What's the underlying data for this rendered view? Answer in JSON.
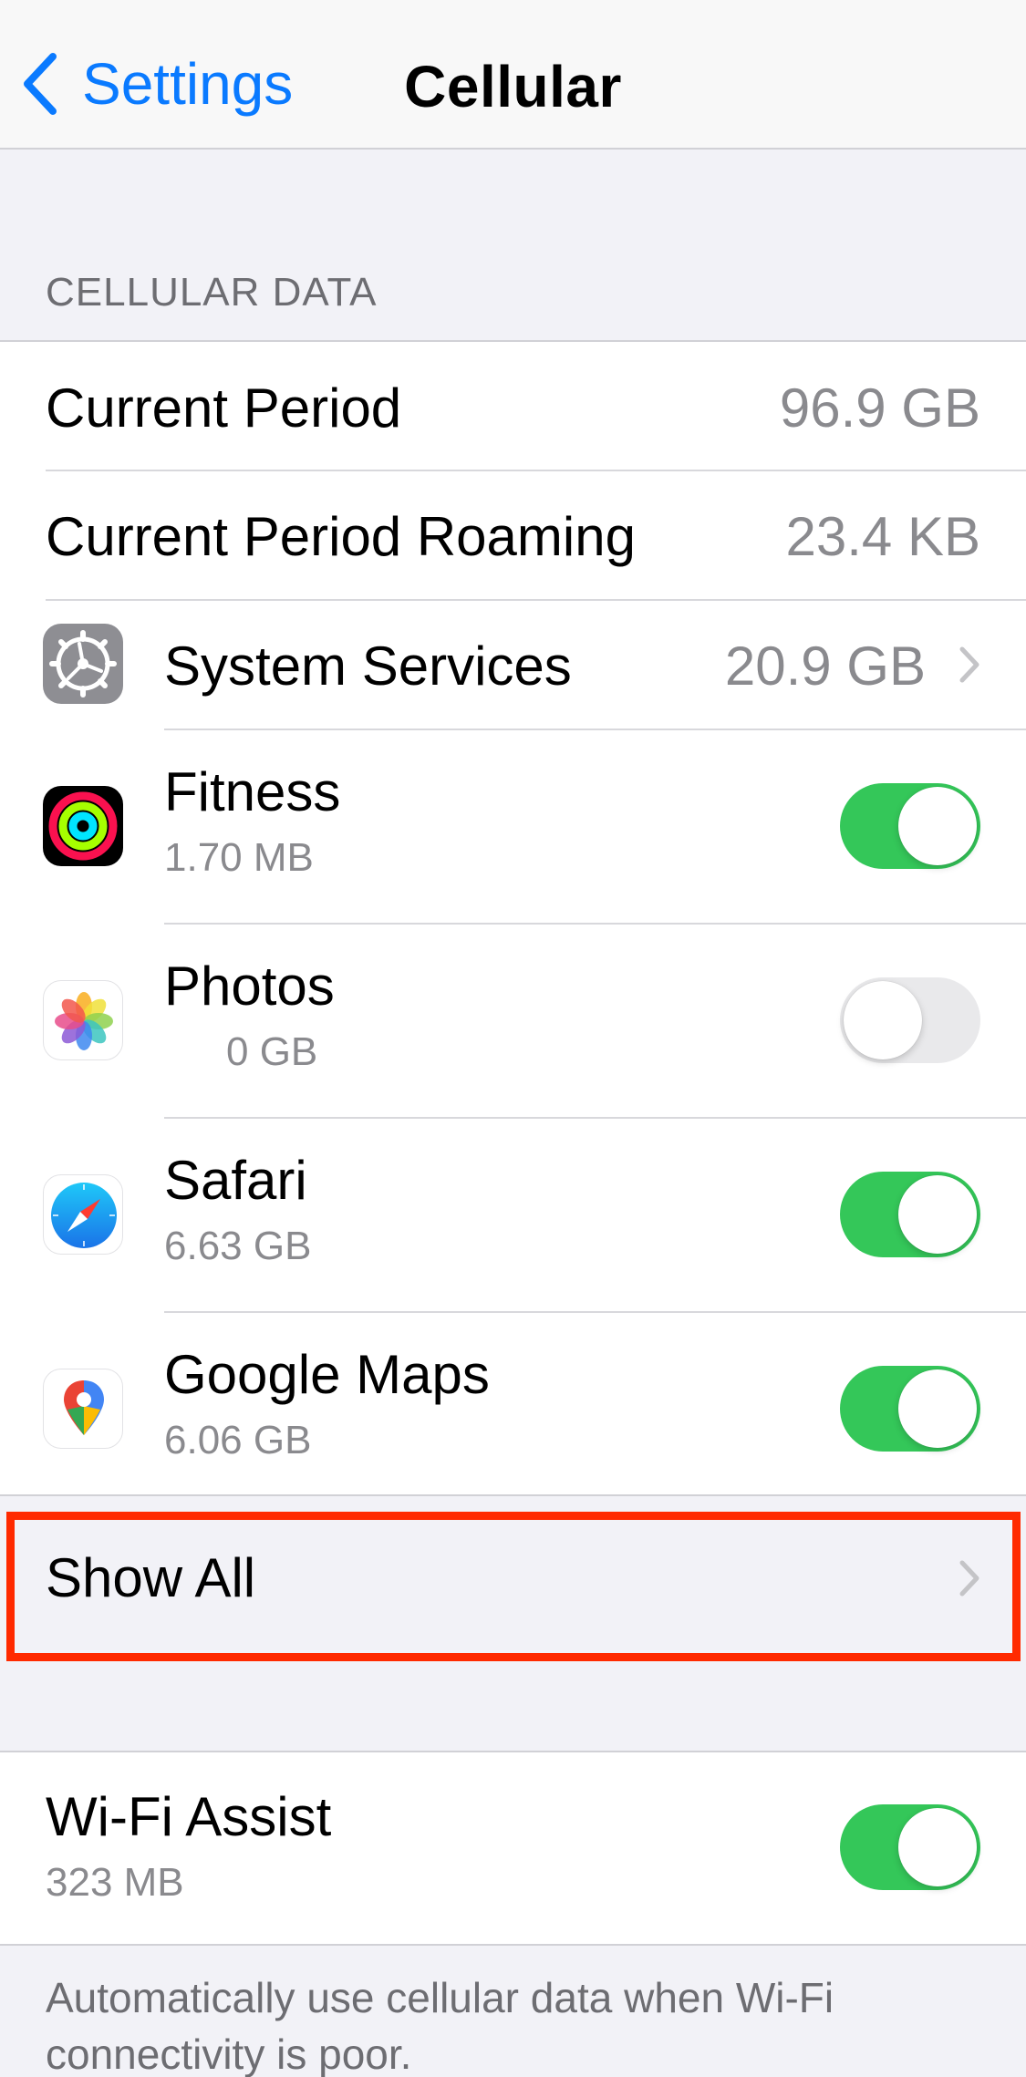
{
  "navbar": {
    "back_label": "Settings",
    "title": "Cellular"
  },
  "cellular_data": {
    "header": "CELLULAR DATA",
    "current_period": {
      "label": "Current Period",
      "value": "96.9 GB"
    },
    "current_period_roaming": {
      "label": "Current Period Roaming",
      "value": "23.4 KB"
    },
    "system_services": {
      "label": "System Services",
      "value": "20.9 GB",
      "icon": "gear-icon"
    },
    "apps": [
      {
        "name": "Fitness",
        "usage": "1.70 MB",
        "enabled": true,
        "icon": "fitness-icon"
      },
      {
        "name": "Photos",
        "usage": "0 GB",
        "enabled": false,
        "icon": "photos-icon"
      },
      {
        "name": "Safari",
        "usage": "6.63 GB",
        "enabled": true,
        "icon": "safari-icon"
      },
      {
        "name": "Google Maps",
        "usage": "6.06 GB",
        "enabled": true,
        "icon": "google-maps-icon"
      }
    ],
    "show_all_label": "Show All"
  },
  "wifi_assist": {
    "label": "Wi-Fi Assist",
    "usage": "323 MB",
    "enabled": true,
    "footer": "Automatically use cellular data when Wi-Fi connectivity is poor."
  },
  "colors": {
    "accent": "#0a7aff",
    "toggle_on": "#34c759",
    "toggle_off": "#e9e9eb",
    "highlight": "#ff2a00",
    "background": "#f2f2f7"
  }
}
